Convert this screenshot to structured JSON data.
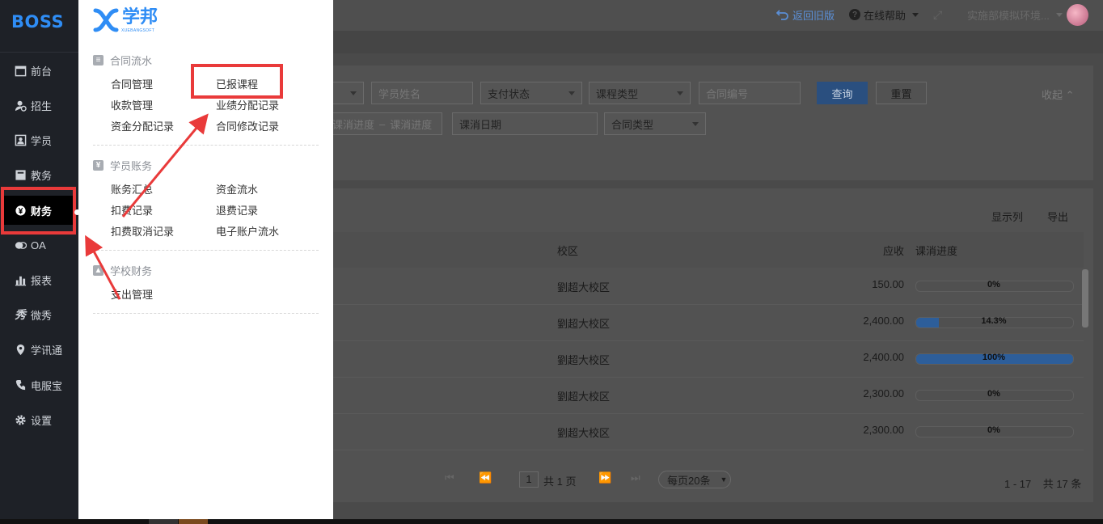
{
  "sidebar": {
    "logo": "BOSS",
    "items": [
      {
        "label": "前台",
        "icon": "calendar-icon"
      },
      {
        "label": "招生",
        "icon": "user-add-icon"
      },
      {
        "label": "学员",
        "icon": "student-card-icon"
      },
      {
        "label": "教务",
        "icon": "book-icon"
      },
      {
        "label": "财务",
        "icon": "yuan-icon",
        "active": true
      },
      {
        "label": "OA",
        "icon": "chat-icon"
      },
      {
        "label": "报表",
        "icon": "bar-chart-icon"
      },
      {
        "label": "微秀",
        "icon": "xiu-icon"
      },
      {
        "label": "学讯通",
        "icon": "location-icon"
      },
      {
        "label": "电服宝",
        "icon": "phone-icon"
      },
      {
        "label": "设置",
        "icon": "gear-icon"
      }
    ]
  },
  "panel": {
    "brand_name": "学邦",
    "brand_sub": "XUEBANGSOFT",
    "groups": [
      {
        "title": "合同流水",
        "links": [
          "合同管理",
          "已报课程",
          "收款管理",
          "业绩分配记录",
          "资金分配记录",
          "合同修改记录"
        ]
      },
      {
        "title": "学员账务",
        "links": [
          "账务汇总",
          "资金流水",
          "扣费记录",
          "退费记录",
          "扣费取消记录",
          "电子账户流水"
        ]
      },
      {
        "title": "学校财务",
        "links": [
          "支出管理"
        ]
      }
    ]
  },
  "topbar": {
    "back_old": "返回旧版",
    "help": "在线帮助",
    "env": "实施部模拟环境..."
  },
  "filters": {
    "student_name": "学员姓名",
    "pay_status": "支付状态",
    "course_type": "课程类型",
    "contract_no": "合同编号",
    "query": "查询",
    "reset": "重置",
    "collapse": "收起",
    "progress_from": "课消进度",
    "progress_sep": "–",
    "progress_to": "课消进度",
    "consume_date": "课消日期",
    "contract_type": "合同类型"
  },
  "table": {
    "toolbar": {
      "columns": "显示列",
      "export": "导出"
    },
    "headers": {
      "campus": "校区",
      "receivable": "应收",
      "progress": "课消进度"
    },
    "rows": [
      {
        "campus": "劉超大校区",
        "amount": "150.00",
        "progress_text": "0%",
        "progress": 0
      },
      {
        "campus": "劉超大校区",
        "amount": "2,400.00",
        "progress_text": "14.3%",
        "progress": 0.143
      },
      {
        "campus": "劉超大校区",
        "amount": "2,400.00",
        "progress_text": "100%",
        "progress": 1
      },
      {
        "campus": "劉超大校区",
        "amount": "2,300.00",
        "progress_text": "0%",
        "progress": 0
      },
      {
        "campus": "劉超大校区",
        "amount": "2,300.00",
        "progress_text": "0%",
        "progress": 0
      }
    ]
  },
  "pager": {
    "page": "1",
    "total_pages": "共 1 页",
    "page_size": "每页20条",
    "range": "1 - 17",
    "total": "共 17 条"
  },
  "colors": {
    "highlight": "#e93a3a",
    "brand_blue": "#2f8df5",
    "sidebar_bg": "#1e2127"
  }
}
